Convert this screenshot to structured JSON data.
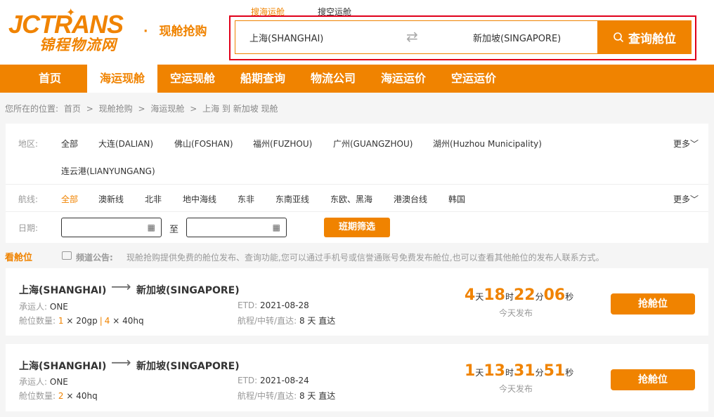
{
  "brand": {
    "logo_en": "JCTRANS",
    "logo_cn": "锦程物流网",
    "slogan_dot": "·",
    "slogan": "现舱抢购",
    "accent": "#f08300"
  },
  "search": {
    "tab_sea": "搜海运舱",
    "tab_air": "搜空运舱",
    "from": "上海(SHANGHAI)",
    "swap_icon": "swap-arrows-icon",
    "to": "新加坡(SINGAPORE)",
    "button": "查询舱位"
  },
  "nav": [
    {
      "label": "首页"
    },
    {
      "label": "海运现舱"
    },
    {
      "label": "空运现舱"
    },
    {
      "label": "船期查询"
    },
    {
      "label": "物流公司"
    },
    {
      "label": "海运运价"
    },
    {
      "label": "空运运价"
    }
  ],
  "breadcrumb": {
    "prefix": "您所在的位置:",
    "items": [
      "首页",
      ">",
      "现舱抢购",
      ">",
      "海运现舱",
      ">",
      "上海 到 新加坡 现舱"
    ]
  },
  "filters": {
    "region_label": "地区:",
    "regions": [
      "全部",
      "大连(DALIAN)",
      "佛山(FOSHAN)",
      "福州(FUZHOU)",
      "广州(GUANGZHOU)",
      "湖州(Huzhou Municipality)",
      "连云港(LIANYUNGANG)"
    ],
    "more": "更多",
    "route_label": "航线:",
    "routes": [
      "全部",
      "澳新线",
      "北非",
      "地中海线",
      "东非",
      "东南亚线",
      "东欧、黑海",
      "港澳台线",
      "韩国"
    ],
    "date_label": "日期:",
    "date_sep": "至",
    "date_from": "",
    "date_to": "",
    "filter_button": "班期筛选"
  },
  "notice": {
    "title": "看舱位",
    "label": "频道公告:",
    "text": "现舱抢购提供免费的舱位发布、查询功能,您可以通过手机号或信誉通账号免费发布舱位,也可以查看其他舱位的发布人联系方式。"
  },
  "listings": [
    {
      "from": "上海(SHANGHAI)",
      "to": "新加坡(SINGAPORE)",
      "carrier_label": "承运人:",
      "carrier": "ONE",
      "qty_label": "舱位数量:",
      "qty1_n": "1",
      "qty1_t": "× 20gp",
      "sep": "|",
      "qty2_n": "4",
      "qty2_t": "× 40hq",
      "etd_label": "ETD:",
      "etd": "2021-08-28",
      "transit_label": "航程/中转/直达:",
      "transit": "8 天 直达",
      "days": "4",
      "hours": "18",
      "mins": "22",
      "secs": "06",
      "u_day": "天",
      "u_hour": "时",
      "u_min": "分",
      "u_sec": "秒",
      "published": "今天发布",
      "button": "抢舱位"
    },
    {
      "from": "上海(SHANGHAI)",
      "to": "新加坡(SINGAPORE)",
      "carrier_label": "承运人:",
      "carrier": "ONE",
      "qty_label": "舱位数量:",
      "qty1_n": "2",
      "qty1_t": "× 40hq",
      "etd_label": "ETD:",
      "etd": "2021-08-24",
      "transit_label": "航程/中转/直达:",
      "transit": "8 天 直达",
      "days": "1",
      "hours": "13",
      "mins": "31",
      "secs": "51",
      "u_day": "天",
      "u_hour": "时",
      "u_min": "分",
      "u_sec": "秒",
      "published": "今天发布",
      "button": "抢舱位"
    }
  ]
}
